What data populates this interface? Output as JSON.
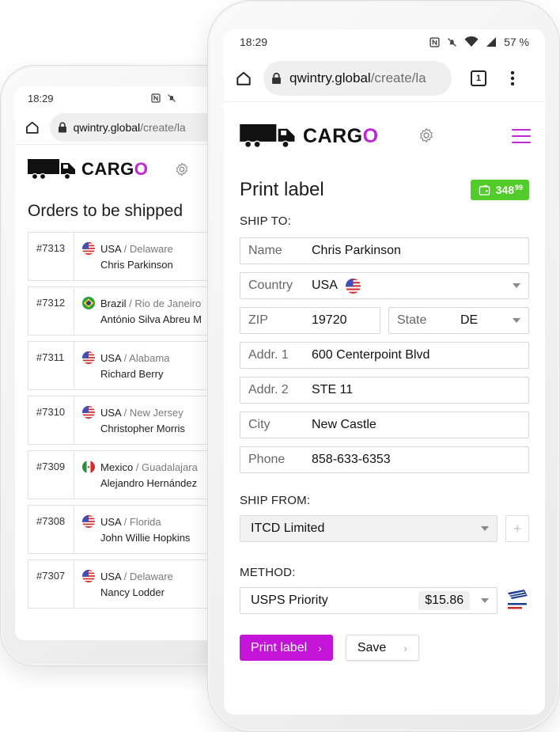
{
  "colors": {
    "accent": "#c026d3",
    "button_primary": "#c414d8",
    "balance_green": "#52cc2b"
  },
  "back_phone": {
    "status_time": "18:29",
    "url": {
      "host": "qwintry.global",
      "path": "/create/la"
    },
    "logo": {
      "text_main": "CARG",
      "text_o": "O"
    },
    "orders_title": "Orders to be shipped",
    "orders": [
      {
        "number": "#7313",
        "flag": "usa",
        "country": "USA",
        "region": "/ Delaware",
        "name": "Chris Parkinson"
      },
      {
        "number": "#7312",
        "flag": "brazil",
        "country": "Brazil",
        "region": "/ Rio de Janeiro",
        "name": "António Silva Abreu M"
      },
      {
        "number": "#7311",
        "flag": "usa",
        "country": "USA",
        "region": "/ Alabama",
        "name": "Richard Berry"
      },
      {
        "number": "#7310",
        "flag": "usa",
        "country": "USA",
        "region": "/ New Jersey",
        "name": "Christopher Morris"
      },
      {
        "number": "#7309",
        "flag": "mexico",
        "country": "Mexico",
        "region": "/ Guadalajara",
        "name": "Alejandro Hernández"
      },
      {
        "number": "#7308",
        "flag": "usa",
        "country": "USA",
        "region": "/ Florida",
        "name": "John Willie Hopkins"
      },
      {
        "number": "#7307",
        "flag": "usa",
        "country": "USA",
        "region": "/ Delaware",
        "name": "Nancy Lodder"
      }
    ]
  },
  "front_phone": {
    "status_time": "18:29",
    "battery": "57 %",
    "url": {
      "host": "qwintry.global",
      "path": "/create/la"
    },
    "tab_count": "1",
    "logo": {
      "text_main": "CARG",
      "text_o": "O"
    },
    "page_title": "Print label",
    "balance": {
      "whole": "348",
      "fraction": "99"
    },
    "ship_to_label": "SHIP TO:",
    "ship_to": {
      "name": {
        "label": "Name",
        "value": "Chris Parkinson"
      },
      "country": {
        "label": "Country",
        "value": "USA",
        "flag": "usa"
      },
      "zip": {
        "label": "ZIP",
        "value": "19720"
      },
      "state": {
        "label": "State",
        "value": "DE"
      },
      "addr1": {
        "label": "Addr. 1",
        "value": "600 Centerpoint Blvd"
      },
      "addr2": {
        "label": "Addr. 2",
        "value": "STE 11"
      },
      "city": {
        "label": "City",
        "value": "New Castle"
      },
      "phone": {
        "label": "Phone",
        "value": "858-633-6353"
      }
    },
    "ship_from_label": "SHIP FROM:",
    "ship_from_value": "ITCD Limited",
    "plus_label": "+",
    "method_label": "METHOD:",
    "method": {
      "value": "USPS Priority",
      "price": "$15.86",
      "carrier_icon": "usps-priority-icon"
    },
    "buttons": {
      "print": "Print label",
      "save": "Save",
      "chevron": "›"
    }
  }
}
